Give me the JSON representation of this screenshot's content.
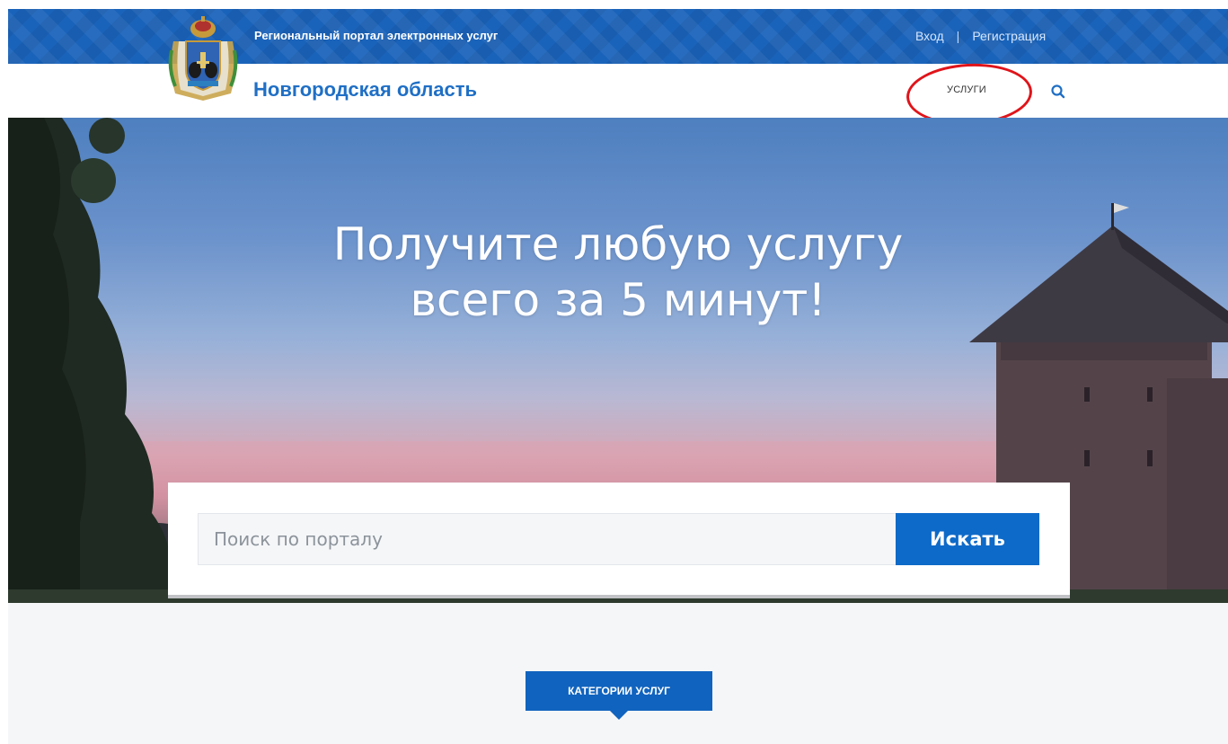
{
  "topbar": {
    "portal_name": "Региональный портал электронных услуг",
    "login": "Вход",
    "separator": "|",
    "register": "Регистрация"
  },
  "header": {
    "region": "Новгородская область",
    "nav_services": "УСЛУГИ",
    "search_icon": "search-icon",
    "annotation_color": "#e0141a"
  },
  "hero": {
    "title_line1": "Получите любую услугу",
    "title_line2": "всего за 5 минут!"
  },
  "search": {
    "placeholder": "Поиск по порталу",
    "button": "Искать"
  },
  "categories": {
    "label": "КАТЕГОРИИ УСЛУГ"
  },
  "colors": {
    "brand_blue": "#1a63ba",
    "button_blue": "#0e6ac8",
    "region_text": "#1f6fc5"
  }
}
